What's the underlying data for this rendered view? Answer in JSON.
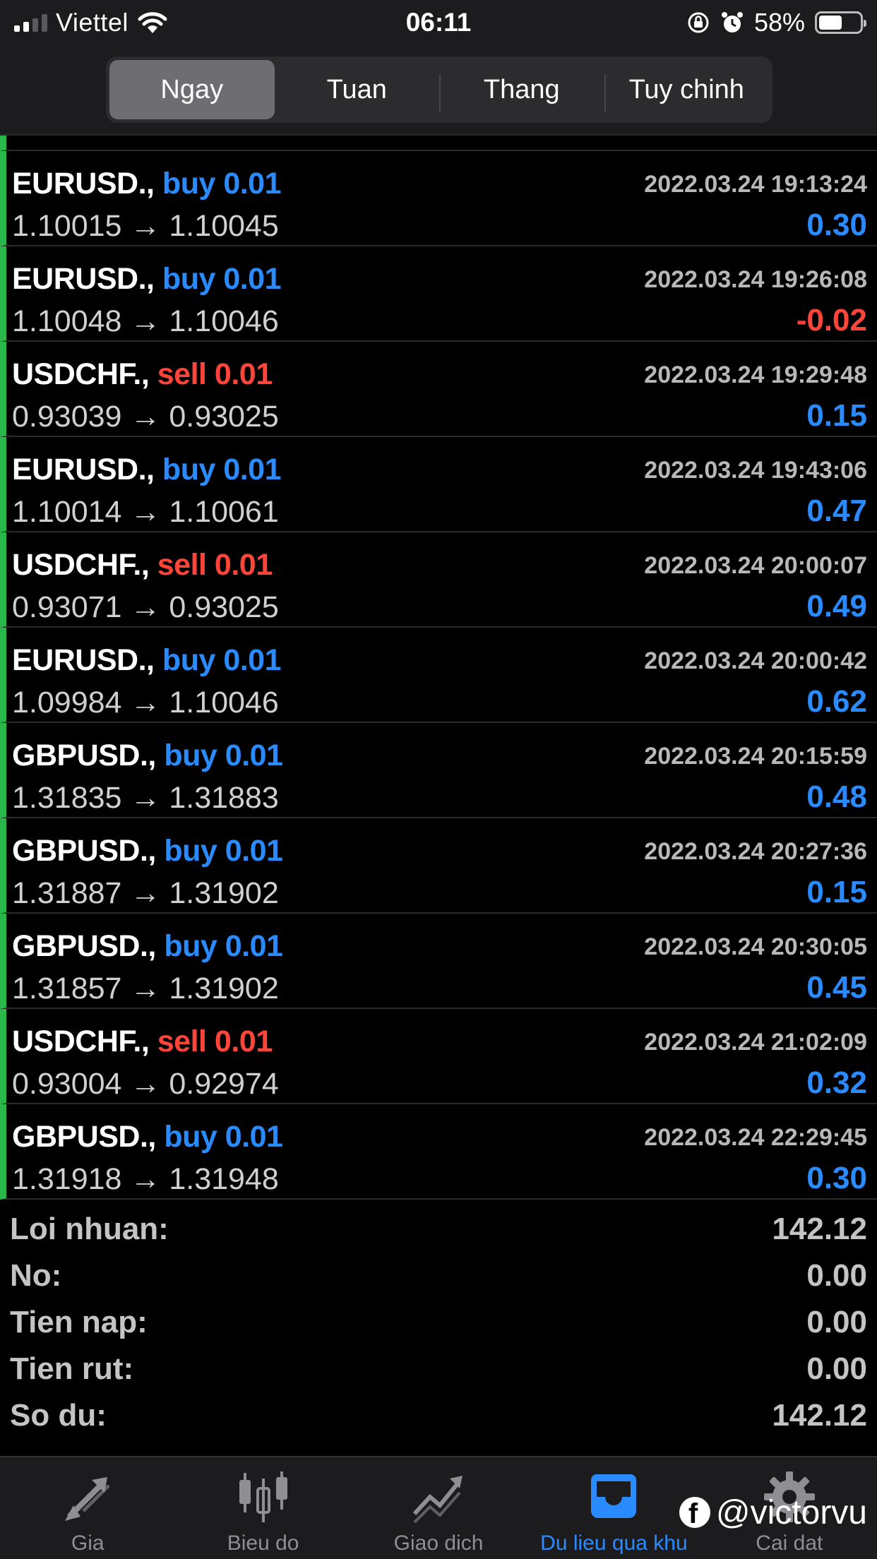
{
  "status_bar": {
    "carrier": "Viettel",
    "time": "06:11",
    "battery_percent": "58%",
    "battery_level": 0.58,
    "signal_bars_active": 2,
    "icons": [
      "signal-icon",
      "wifi-icon",
      "rotation-lock-icon",
      "alarm-icon",
      "battery-icon"
    ]
  },
  "period_tabs": {
    "items": [
      "Ngay",
      "Tuan",
      "Thang",
      "Tuy chinh"
    ],
    "selected": "Ngay"
  },
  "trades": [
    {
      "symbol": "EURUSD.,",
      "side": "buy 0.01",
      "side_type": "buy",
      "prices": "1.10015 → 1.10045",
      "time": "2022.03.24 19:13:24",
      "profit": "0.30"
    },
    {
      "symbol": "EURUSD.,",
      "side": "buy 0.01",
      "side_type": "buy",
      "prices": "1.10048 → 1.10046",
      "time": "2022.03.24 19:26:08",
      "profit": "-0.02"
    },
    {
      "symbol": "USDCHF.,",
      "side": "sell 0.01",
      "side_type": "sell",
      "prices": "0.93039 → 0.93025",
      "time": "2022.03.24 19:29:48",
      "profit": "0.15"
    },
    {
      "symbol": "EURUSD.,",
      "side": "buy 0.01",
      "side_type": "buy",
      "prices": "1.10014 → 1.10061",
      "time": "2022.03.24 19:43:06",
      "profit": "0.47"
    },
    {
      "symbol": "USDCHF.,",
      "side": "sell 0.01",
      "side_type": "sell",
      "prices": "0.93071 → 0.93025",
      "time": "2022.03.24 20:00:07",
      "profit": "0.49"
    },
    {
      "symbol": "EURUSD.,",
      "side": "buy 0.01",
      "side_type": "buy",
      "prices": "1.09984 → 1.10046",
      "time": "2022.03.24 20:00:42",
      "profit": "0.62"
    },
    {
      "symbol": "GBPUSD.,",
      "side": "buy 0.01",
      "side_type": "buy",
      "prices": "1.31835 → 1.31883",
      "time": "2022.03.24 20:15:59",
      "profit": "0.48"
    },
    {
      "symbol": "GBPUSD.,",
      "side": "buy 0.01",
      "side_type": "buy",
      "prices": "1.31887 → 1.31902",
      "time": "2022.03.24 20:27:36",
      "profit": "0.15"
    },
    {
      "symbol": "GBPUSD.,",
      "side": "buy 0.01",
      "side_type": "buy",
      "prices": "1.31857 → 1.31902",
      "time": "2022.03.24 20:30:05",
      "profit": "0.45"
    },
    {
      "symbol": "USDCHF.,",
      "side": "sell 0.01",
      "side_type": "sell",
      "prices": "0.93004 → 0.92974",
      "time": "2022.03.24 21:02:09",
      "profit": "0.32"
    },
    {
      "symbol": "GBPUSD.,",
      "side": "buy 0.01",
      "side_type": "buy",
      "prices": "1.31918 → 1.31948",
      "time": "2022.03.24 22:29:45",
      "profit": "0.30"
    }
  ],
  "summary": [
    {
      "label": "Loi nhuan:",
      "value": "142.12"
    },
    {
      "label": "No:",
      "value": "0.00"
    },
    {
      "label": "Tien nap:",
      "value": "0.00"
    },
    {
      "label": "Tien rut:",
      "value": "0.00"
    },
    {
      "label": "So du:",
      "value": "142.12"
    }
  ],
  "tab_bar": {
    "items": [
      {
        "label": "Gia",
        "icon": "price-arrows-icon"
      },
      {
        "label": "Bieu do",
        "icon": "candlestick-chart-icon"
      },
      {
        "label": "Giao dich",
        "icon": "trade-trend-icon"
      },
      {
        "label": "Du lieu qua khu",
        "icon": "history-inbox-icon"
      },
      {
        "label": "Cai dat",
        "icon": "gear-icon"
      }
    ],
    "selected": "Du lieu qua khu"
  },
  "watermark": {
    "icon": "facebook-icon",
    "handle": "@victorvu"
  },
  "colors": {
    "buy": "#2a8bff",
    "sell": "#ff453a",
    "profit_positive": "#2a8bff",
    "profit_negative": "#ff453a",
    "row_marker": "#2bb84a",
    "active_tab": "#2a8bff"
  }
}
